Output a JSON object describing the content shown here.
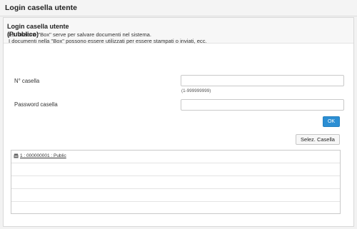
{
  "page_title": "Login casella utente",
  "card": {
    "title_line1": "Login casella utente",
    "title_line2": "(Pubblico)"
  },
  "description": {
    "line1": "La funzione \"Box\" serve per salvare documenti nel sistema.",
    "line2": "I documenti nella \"Box\" possono essere utilizzati per essere stampati o inviati, ecc."
  },
  "form": {
    "box_number_label": "N° casella",
    "box_number_value": "",
    "box_number_hint": "(1-999999999)",
    "password_label": "Password casella",
    "password_value": ""
  },
  "buttons": {
    "ok": "OK",
    "select_box": "Selez. Casella"
  },
  "box_list": [
    {
      "label": "1 : 000000001 : Public",
      "icon": "box-tray-icon"
    }
  ],
  "colors": {
    "accent": "#2b8ed3",
    "background": "#f2f2f2"
  }
}
